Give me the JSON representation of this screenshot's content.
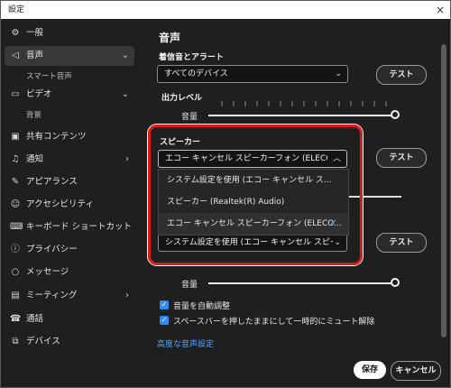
{
  "window": {
    "title": "設定",
    "close_glyph": "×"
  },
  "sidebar": {
    "items": [
      {
        "label": "一般",
        "icon": "gear-icon",
        "glyph": "⚙"
      },
      {
        "label": "音声",
        "icon": "speaker-icon",
        "glyph": "◁",
        "expanded": true,
        "active": true
      },
      {
        "label": "スマート音声",
        "sub": true
      },
      {
        "label": "ビデオ",
        "icon": "video-camera-icon",
        "glyph": "▭",
        "expanded": true
      },
      {
        "label": "背景",
        "sub": true
      },
      {
        "label": "共有コンテンツ",
        "icon": "share-screen-icon",
        "glyph": "▣"
      },
      {
        "label": "通知",
        "icon": "bell-icon",
        "glyph": "♫"
      },
      {
        "label": "アピアランス",
        "icon": "appearance-icon",
        "glyph": "✎"
      },
      {
        "label": "アクセシビリティ",
        "icon": "accessibility-icon",
        "glyph": "☺"
      },
      {
        "label": "キーボード ショートカット",
        "icon": "keyboard-icon",
        "glyph": "⌨"
      },
      {
        "label": "プライバシー",
        "icon": "privacy-icon",
        "glyph": "ⓘ"
      },
      {
        "label": "メッセージ",
        "icon": "chat-bubble-icon",
        "glyph": "○"
      },
      {
        "label": "ミーティング",
        "icon": "calendar-icon",
        "glyph": "▤"
      },
      {
        "label": "通話",
        "icon": "phone-icon",
        "glyph": "☎"
      },
      {
        "label": "デバイス",
        "icon": "devices-icon",
        "glyph": "⧉"
      }
    ],
    "chevron_down": "⌄",
    "chevron_right": "›"
  },
  "main": {
    "title": "音声",
    "ringtone": {
      "heading": "着信音とアラート",
      "device_value": "すべてのデバイス",
      "test_label": "テスト"
    },
    "output": {
      "label": "出力レベル",
      "volume_label": "音量",
      "volume_level": 1.0
    },
    "speaker": {
      "heading": "スピーカー",
      "device_value": "エコー キャンセル スピーカーフォン (ELECOM",
      "test_label": "テスト",
      "options": [
        {
          "label": "システム設定を使用 (エコー キャンセル ス...",
          "selected": false
        },
        {
          "label": "スピーカー (Realtek(R) Audio)",
          "selected": false
        },
        {
          "label": "エコー キャンセル スピーカーフォン (ELECO...",
          "selected": true
        }
      ],
      "check_glyph": "✓"
    },
    "microphone": {
      "device_value": "システム設定を使用 (エコー キャンセル スピー",
      "test_label": "テスト",
      "volume_label": "音量",
      "volume_level": 1.0
    },
    "auto_adjust": {
      "label": "音量を自動調整",
      "checked": true
    },
    "push_to_talk": {
      "label": "スペースバーを押したままにして一時的にミュート解除",
      "checked": true
    },
    "advanced_link": "高度な音声設定",
    "save_label": "保存",
    "cancel_label": "キャンセル"
  },
  "colors": {
    "accent": "#2d8cff",
    "link": "#4ea6ff",
    "highlight": "#e21919",
    "background": "#1f1f1f"
  }
}
